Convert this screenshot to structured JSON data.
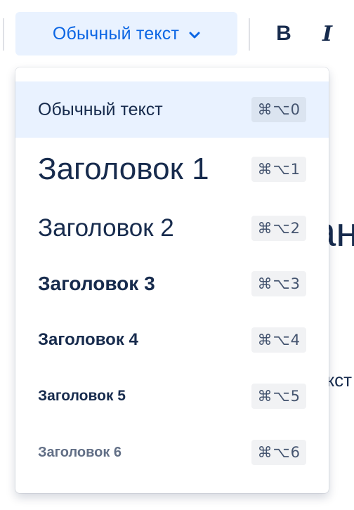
{
  "toolbar": {
    "style_select": {
      "label": "Обычный текст",
      "icon": "chevron-down-icon"
    },
    "bold": {
      "label": "B",
      "icon": "bold-icon"
    },
    "italic": {
      "label": "I",
      "icon": "italic-icon"
    }
  },
  "document": {
    "heading_fragment": "ан",
    "paragraph_fragment": "екст"
  },
  "dropdown": {
    "items": [
      {
        "label": "Обычный текст",
        "shortcut": "⌘⌥0",
        "selected": true
      },
      {
        "label": "Заголовок 1",
        "shortcut": "⌘⌥1",
        "selected": false
      },
      {
        "label": "Заголовок 2",
        "shortcut": "⌘⌥2",
        "selected": false
      },
      {
        "label": "Заголовок 3",
        "shortcut": "⌘⌥3",
        "selected": false
      },
      {
        "label": "Заголовок 4",
        "shortcut": "⌘⌥4",
        "selected": false
      },
      {
        "label": "Заголовок 5",
        "shortcut": "⌘⌥5",
        "selected": false
      },
      {
        "label": "Заголовок 6",
        "shortcut": "⌘⌥6",
        "selected": false
      }
    ]
  },
  "colors": {
    "accent": "#0c66e4",
    "selected_bg": "#e9f2ff",
    "text": "#172b4d",
    "muted_text": "#626f86",
    "kbd_bg": "#f1f2f4"
  }
}
